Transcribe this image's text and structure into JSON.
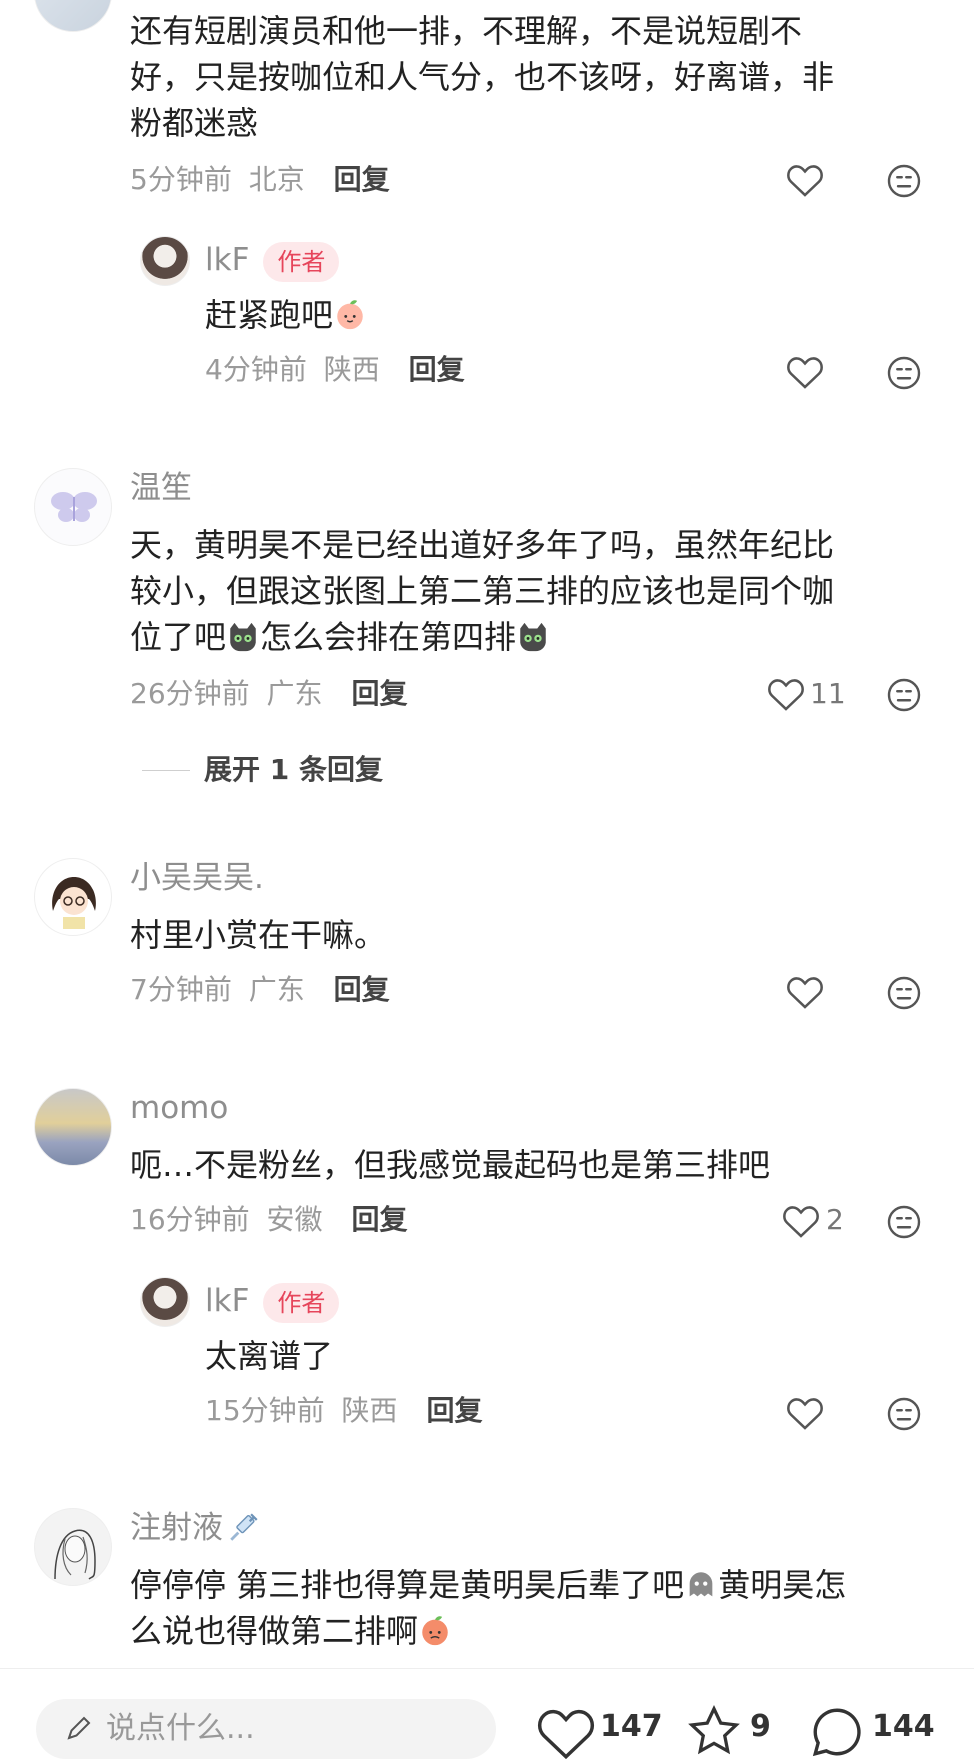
{
  "comments": [
    {
      "text": "还有短剧演员和他一排，不理解，不是说短剧不好，只是按咖位和人气分，也不该呀，好离谱，非粉都迷惑",
      "time": "5分钟前",
      "location": "北京",
      "reply_label": "回复",
      "likes": ""
    },
    {
      "name": "lkF",
      "badge": "作者",
      "text": "赶紧跑吧",
      "time": "4分钟前",
      "location": "陕西",
      "reply_label": "回复",
      "likes": ""
    },
    {
      "name": "温笙",
      "text_a": "天，黄明昊不是已经出道好多年了吗，虽然年纪比较小，但跟这张图上第二第三排的应该也是同个咖位了吧",
      "text_b": "怎么会排在第四排",
      "time": "26分钟前",
      "location": "广东",
      "reply_label": "回复",
      "likes": "11",
      "expand_label": "展开 1 条回复"
    },
    {
      "name": "小吴吴吴.",
      "text": "村里小赏在干嘛。",
      "time": "7分钟前",
      "location": "广东",
      "reply_label": "回复",
      "likes": ""
    },
    {
      "name": "momo",
      "text": "呃…不是粉丝，但我感觉最起码也是第三排吧",
      "time": "16分钟前",
      "location": "安徽",
      "reply_label": "回复",
      "likes": "2"
    },
    {
      "name": "lkF",
      "badge": "作者",
      "text": "太离谱了",
      "time": "15分钟前",
      "location": "陕西",
      "reply_label": "回复",
      "likes": ""
    },
    {
      "name": "注射液",
      "text_a": "停停停 第三排也得算是黄明昊后辈了吧",
      "text_b": "黄明昊怎么说也得做第二排啊"
    }
  ],
  "bottom_bar": {
    "input_placeholder": "说点什么...",
    "like_count": "147",
    "collect_count": "9",
    "comment_count": "144"
  },
  "icons": [
    "heart-icon",
    "dislike-face-icon",
    "pencil-icon",
    "star-icon",
    "comment-bubble-icon",
    "cat-emoji",
    "peach-emoji",
    "syringe-emoji",
    "ghost-emoji"
  ]
}
